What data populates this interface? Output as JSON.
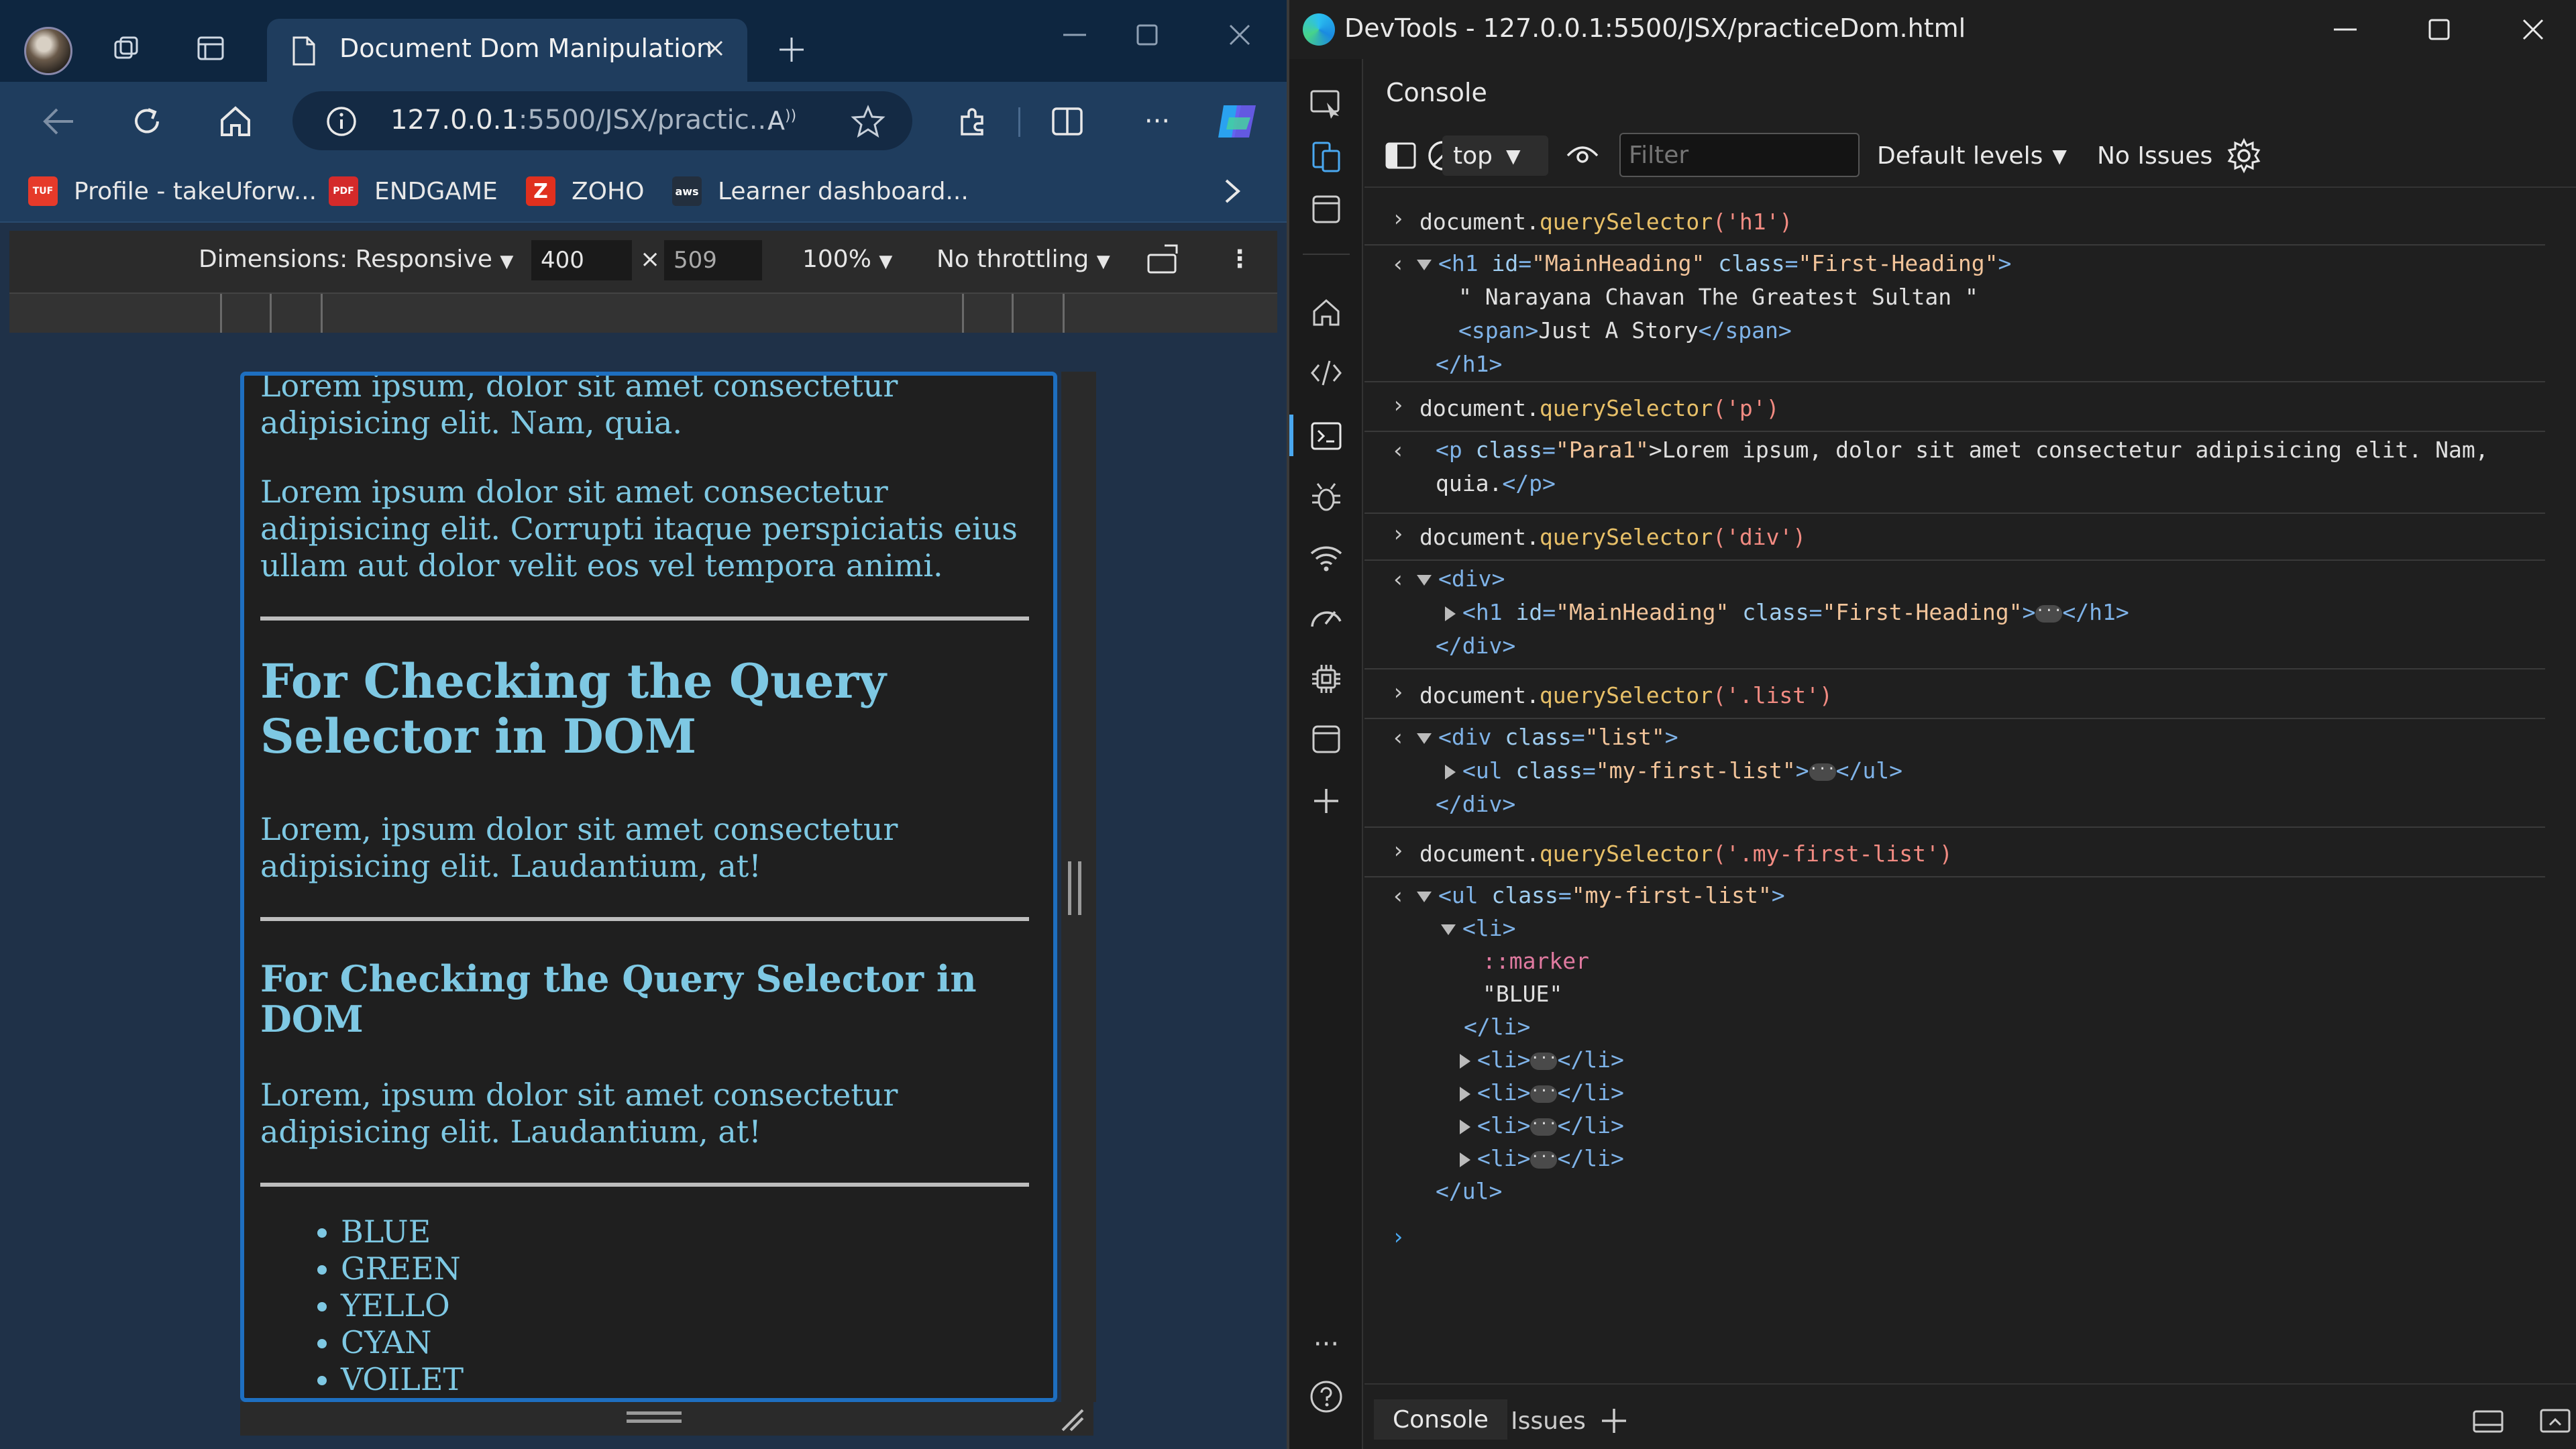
{
  "browser": {
    "tab": {
      "title": "Document Dom Manipulation"
    },
    "address": {
      "host": "127.0.0.1",
      "rest": ":5500/JSX/practic..."
    },
    "read_aloud_label": "A",
    "bookmarks": [
      {
        "badge": "TUF",
        "label": "Profile - takeUforw...",
        "color": "#e63a2a"
      },
      {
        "badge": "PDF",
        "label": "ENDGAME",
        "color": "#d42a2a"
      },
      {
        "badge": "Z",
        "label": "ZOHO",
        "color": "#e0301e"
      },
      {
        "badge": "aws",
        "label": "Learner dashboard...",
        "color": "#232f3e"
      }
    ],
    "device_toolbar": {
      "dimensions_label": "Dimensions: Responsive",
      "width": "400",
      "times": "×",
      "height": "509",
      "zoom": "100%",
      "throttling": "No throttling"
    },
    "page": {
      "para_top": "Lorem ipsum, dolor sit amet consectetur adipisicing elit. Nam, quia.",
      "para_2": "Lorem ipsum dolor sit amet consectetur adipisicing elit. Corrupti itaque perspiciatis eius ullam aut dolor velit eos vel tempora animi.",
      "h1": "For Checking the Query Selector in DOM",
      "para_3": "Lorem, ipsum dolor sit amet consectetur adipisicing elit. Laudantium, at!",
      "h2": "For Checking the Query Selector in DOM",
      "para_4": "Lorem, ipsum dolor sit amet consectetur adipisicing elit. Laudantium, at!",
      "list": [
        "BLUE",
        "GREEN",
        "YELLO",
        "CYAN",
        "VOILET"
      ]
    }
  },
  "devtools": {
    "window_title": "DevTools - 127.0.0.1:5500/JSX/practiceDom.html",
    "panel_title": "Console",
    "toolbar": {
      "context": "top",
      "filter_placeholder": "Filter",
      "levels": "Default levels",
      "issues": "No Issues"
    },
    "bottom_tabs": [
      "Console",
      "Issues"
    ],
    "log": {
      "q1": {
        "pre": "document.",
        "meth": "querySelector",
        "arg": "('h1')"
      },
      "r1": {
        "l1_tag": "<h1",
        "l1_a1": " id",
        "l1_v1": "\"MainHeading\"",
        "l1_a2": " class",
        "l1_v2": "\"First-Heading\"",
        "l1_end": ">",
        "l2": "\" Narayana Chavan The Greatest Sultan \"",
        "l3_open": "<span>",
        "l3_text": "Just A Story",
        "l3_close": "</span>",
        "l4": "</h1>"
      },
      "q2": {
        "pre": "document.",
        "meth": "querySelector",
        "arg": "('p')"
      },
      "r2": {
        "l1_tag": "<p",
        "l1_a1": " class",
        "l1_v1": "\"Para1\"",
        "l1_text": ">Lorem ipsum, dolor sit amet consectetur adipisicing elit. Nam,",
        "l2_text": "quia.",
        "l2_close": "</p>"
      },
      "q3": {
        "pre": "document.",
        "meth": "querySelector",
        "arg": "('div')"
      },
      "r3": {
        "l1": "<div>",
        "l2_tag": "<h1",
        "l2_a1": " id",
        "l2_v1": "\"MainHeading\"",
        "l2_a2": " class",
        "l2_v2": "\"First-Heading\"",
        "l2_gt": ">",
        "l2_close": "</h1>",
        "l3": "</div>"
      },
      "q4": {
        "pre": "document.",
        "meth": "querySelector",
        "arg": "('.list')"
      },
      "r4": {
        "l1_tag": "<div",
        "l1_a1": " class",
        "l1_v1": "\"list\"",
        "l1_end": ">",
        "l2_tag": "<ul",
        "l2_a1": " class",
        "l2_v1": "\"my-first-list\"",
        "l2_gt": ">",
        "l2_close": "</ul>",
        "l3": "</div>"
      },
      "q5": {
        "pre": "document.",
        "meth": "querySelector",
        "arg": "('.my-first-list')"
      },
      "r5": {
        "l1_tag": "<ul",
        "l1_a1": " class",
        "l1_v1": "\"my-first-list\"",
        "l1_end": ">",
        "li_open": "<li>",
        "marker": "::marker",
        "blue": "\"BLUE\"",
        "li_close": "</li>",
        "ul_close": "</ul>"
      },
      "ellipsis": "···"
    }
  },
  "colors": {
    "accent_blue": "#1e6fc0",
    "page_text": "#7ec8e3"
  }
}
